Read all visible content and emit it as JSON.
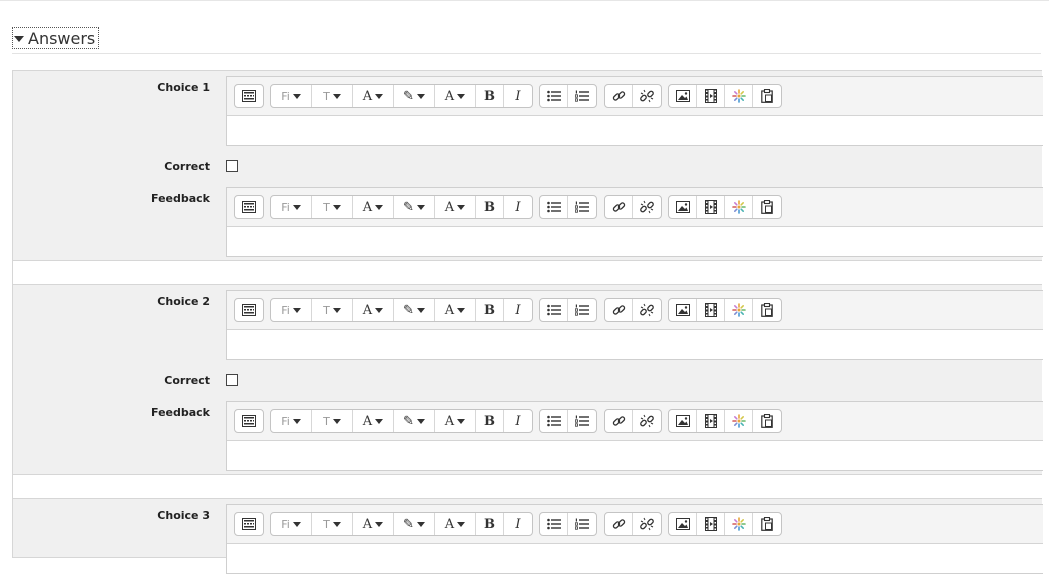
{
  "section": {
    "title": "Answers"
  },
  "choices": [
    {
      "label": "Choice 1",
      "correct_label": "Correct",
      "feedback_label": "Feedback"
    },
    {
      "label": "Choice 2",
      "correct_label": "Correct",
      "feedback_label": "Feedback"
    },
    {
      "label": "Choice 3"
    }
  ],
  "toolbar": {
    "font_family_glyph": "Fi",
    "font_size_glyph": "T",
    "font_color_glyph": "A",
    "highlight_glyph": "✎",
    "style_glyph": "A",
    "bold_glyph": "B",
    "italic_glyph": "I"
  },
  "icons": {
    "toolbar_toggle": "keyboard-icon",
    "unordered_list": "bullet-list-icon",
    "ordered_list": "numbered-list-icon",
    "link": "link-icon",
    "unlink": "unlink-icon",
    "image": "image-icon",
    "media": "film-icon",
    "manage_files": "sparkle-icon",
    "paste": "clipboard-icon"
  }
}
